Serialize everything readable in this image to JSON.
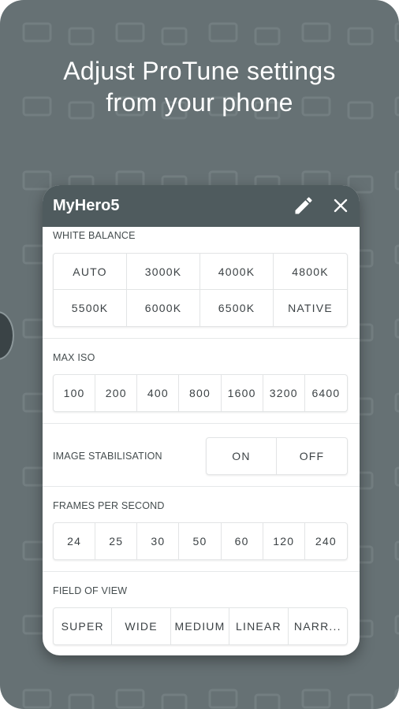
{
  "headline": [
    "Adjust ProTune settings",
    "from your phone"
  ],
  "card": {
    "title": "MyHero5"
  },
  "icons": {
    "edit": "pencil-icon",
    "close": "close-icon"
  },
  "colors": {
    "background": "#667174",
    "header": "#4f5b5e",
    "card": "#ffffff",
    "text": "#3c4245"
  },
  "white_balance": {
    "label": "WHITE BALANCE",
    "options": [
      "AUTO",
      "3000K",
      "4000K",
      "4800K",
      "5500K",
      "6000K",
      "6500K",
      "NATIVE"
    ]
  },
  "max_iso": {
    "label": "MAX ISO",
    "options": [
      "100",
      "200",
      "400",
      "800",
      "1600",
      "3200",
      "6400"
    ]
  },
  "image_stabilisation": {
    "label": "IMAGE STABILISATION",
    "options": [
      "ON",
      "OFF"
    ]
  },
  "frames_per_second": {
    "label": "FRAMES PER SECOND",
    "options": [
      "24",
      "25",
      "30",
      "50",
      "60",
      "120",
      "240"
    ]
  },
  "field_of_view": {
    "label": "FIELD OF VIEW",
    "options": [
      "SUPER",
      "WIDE",
      "MEDIUM",
      "LINEAR",
      "NARR..."
    ]
  }
}
